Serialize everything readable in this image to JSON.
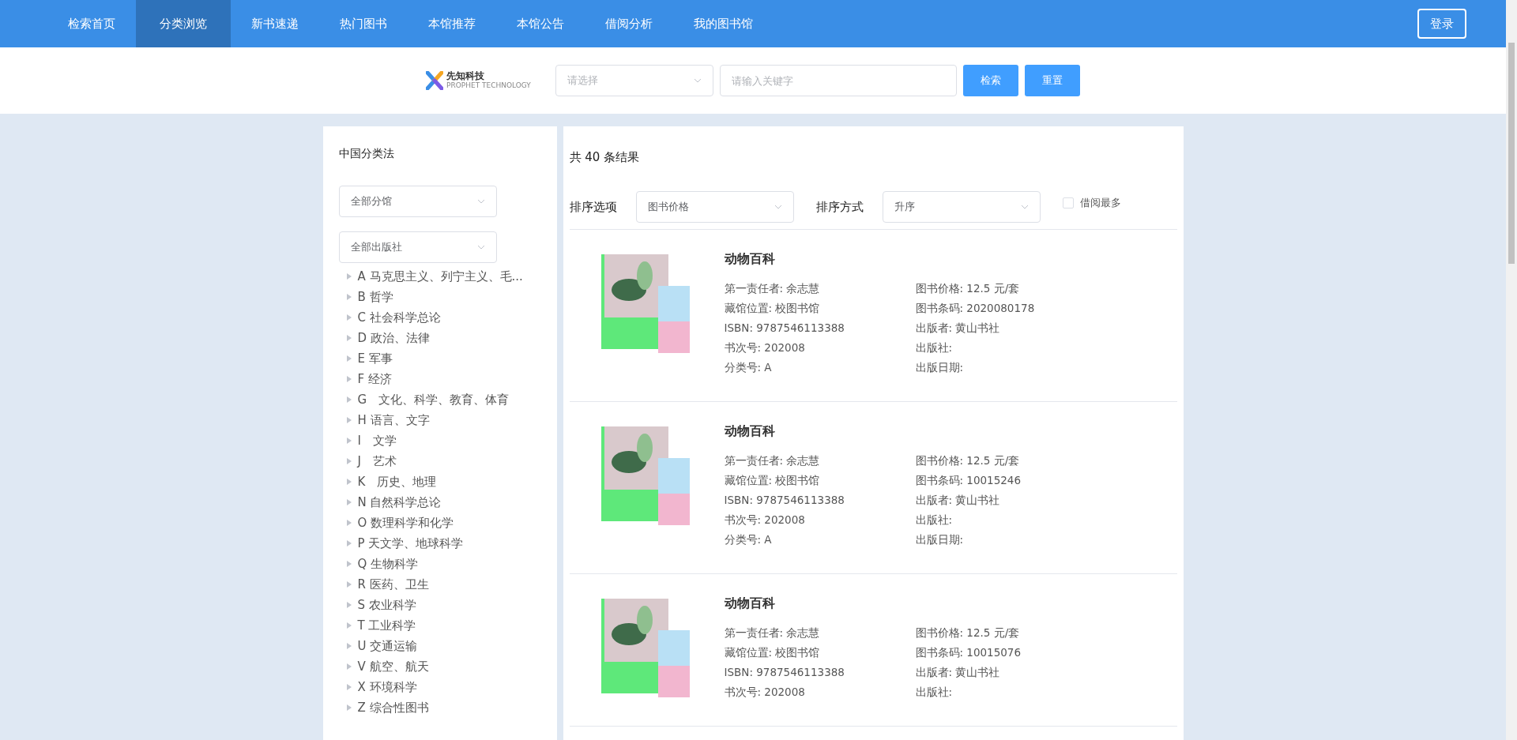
{
  "nav": {
    "items": [
      {
        "label": "检索首页",
        "selected": false
      },
      {
        "label": "分类浏览",
        "selected": true
      },
      {
        "label": "新书速递",
        "selected": false
      },
      {
        "label": "热门图书",
        "selected": false
      },
      {
        "label": "本馆推荐",
        "selected": false
      },
      {
        "label": "本馆公告",
        "selected": false
      },
      {
        "label": "借阅分析",
        "selected": false
      },
      {
        "label": "我的图书馆",
        "selected": false
      }
    ],
    "login": "登录"
  },
  "search": {
    "logo": {
      "name": "先知科技",
      "tagline": "PROPHET TECHNOLOGY"
    },
    "select_placeholder": "请选择",
    "keyword_placeholder": "请输入关键字",
    "search_button": "检索",
    "reset_button": "重置"
  },
  "sidebar": {
    "title": "中国分类法",
    "branch_select": "全部分馆",
    "publisher_select": "全部出版社",
    "tree": [
      {
        "label": "A 马克思主义、列宁主义、毛...",
        "expanded": false
      },
      {
        "label": "B 哲学",
        "expanded": false
      },
      {
        "label": "C 社会科学总论",
        "expanded": false
      },
      {
        "label": "D 政治、法律",
        "expanded": false
      },
      {
        "label": "E 军事",
        "expanded": false
      },
      {
        "label": "F 经济",
        "expanded": false
      },
      {
        "label": "G　文化、科学、教育、体育",
        "expanded": false
      },
      {
        "label": "H 语言、文字",
        "expanded": false
      },
      {
        "label": "I　文学",
        "expanded": false
      },
      {
        "label": "J　艺术",
        "expanded": false
      },
      {
        "label": "K　历史、地理",
        "expanded": false
      },
      {
        "label": "N 自然科学总论",
        "expanded": false
      },
      {
        "label": "O 数理科学和化学",
        "expanded": false
      },
      {
        "label": "P 天文学、地球科学",
        "expanded": false
      },
      {
        "label": "Q 生物科学",
        "expanded": false
      },
      {
        "label": "R 医药、卫生",
        "expanded": false
      },
      {
        "label": "S 农业科学",
        "expanded": false
      },
      {
        "label": "T 工业科学",
        "expanded": false
      },
      {
        "label": "U 交通运输",
        "expanded": false
      },
      {
        "label": "V 航空、航天",
        "expanded": false
      },
      {
        "label": "X 环境科学",
        "expanded": false
      },
      {
        "label": "Z 综合性图书",
        "expanded": false
      }
    ]
  },
  "results": {
    "count_text": "共 40 条结果",
    "sort_option_label": "排序选项",
    "sort_option": "图书价格",
    "sort_order_label": "排序方式",
    "sort_order": "升序",
    "most_borrowed": {
      "label": "借阅最多",
      "checked": false
    },
    "books": [
      {
        "title": "动物百科",
        "fields": [
          "第一责任者: 余志慧",
          "图书价格: 12.5 元/套",
          "藏馆位置: 校图书馆",
          "图书条码: 2020080178",
          "ISBN: 9787546113388",
          "出版者: 黄山书社",
          "书次号: 202008",
          "出版社:",
          "分类号: A",
          "出版日期:"
        ]
      },
      {
        "title": "动物百科",
        "fields": [
          "第一责任者: 余志慧",
          "图书价格: 12.5 元/套",
          "藏馆位置: 校图书馆",
          "图书条码: 10015246",
          "ISBN: 9787546113388",
          "出版者: 黄山书社",
          "书次号: 202008",
          "出版社:",
          "分类号: A",
          "出版日期:"
        ]
      },
      {
        "title": "动物百科",
        "fields": [
          "第一责任者: 余志慧",
          "图书价格: 12.5 元/套",
          "藏馆位置: 校图书馆",
          "图书条码: 10015076",
          "ISBN: 9787546113388",
          "出版者: 黄山书社",
          "书次号: 202008",
          "出版社:"
        ]
      }
    ]
  }
}
